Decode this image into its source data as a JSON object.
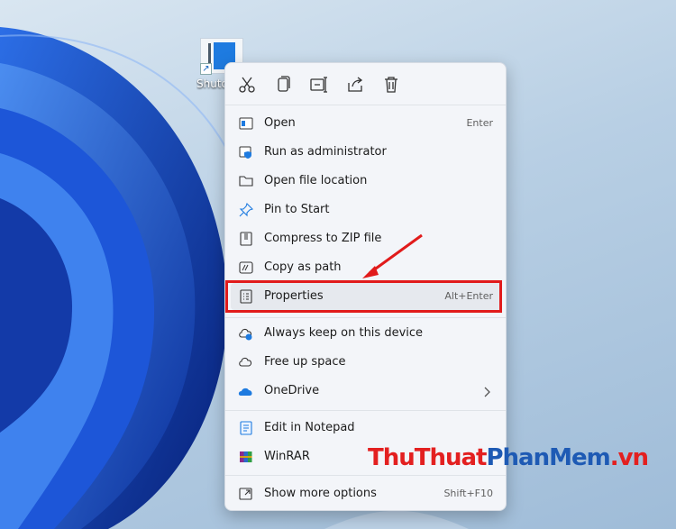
{
  "desktop": {
    "shortcut_label": "Shutdown"
  },
  "toolbar": {
    "icons": [
      "cut-icon",
      "copy-icon",
      "rename-icon",
      "share-icon",
      "delete-icon"
    ]
  },
  "menu": {
    "open": {
      "label": "Open",
      "accel": "Enter"
    },
    "run_admin": {
      "label": "Run as administrator"
    },
    "open_location": {
      "label": "Open file location"
    },
    "pin_start": {
      "label": "Pin to Start"
    },
    "compress_zip": {
      "label": "Compress to ZIP file"
    },
    "copy_path": {
      "label": "Copy as path"
    },
    "properties": {
      "label": "Properties",
      "accel": "Alt+Enter"
    },
    "always_keep": {
      "label": "Always keep on this device"
    },
    "free_space": {
      "label": "Free up space"
    },
    "onedrive": {
      "label": "OneDrive"
    },
    "notepad": {
      "label": "Edit in Notepad"
    },
    "winrar": {
      "label": "WinRAR"
    },
    "more_options": {
      "label": "Show more options",
      "accel": "Shift+F10"
    }
  },
  "watermark": {
    "part1": "ThuThuat",
    "part2": "PhanMem",
    "part3": ".vn"
  },
  "colors": {
    "highlight": "#e11b1b",
    "accent": "#1e7be0"
  }
}
